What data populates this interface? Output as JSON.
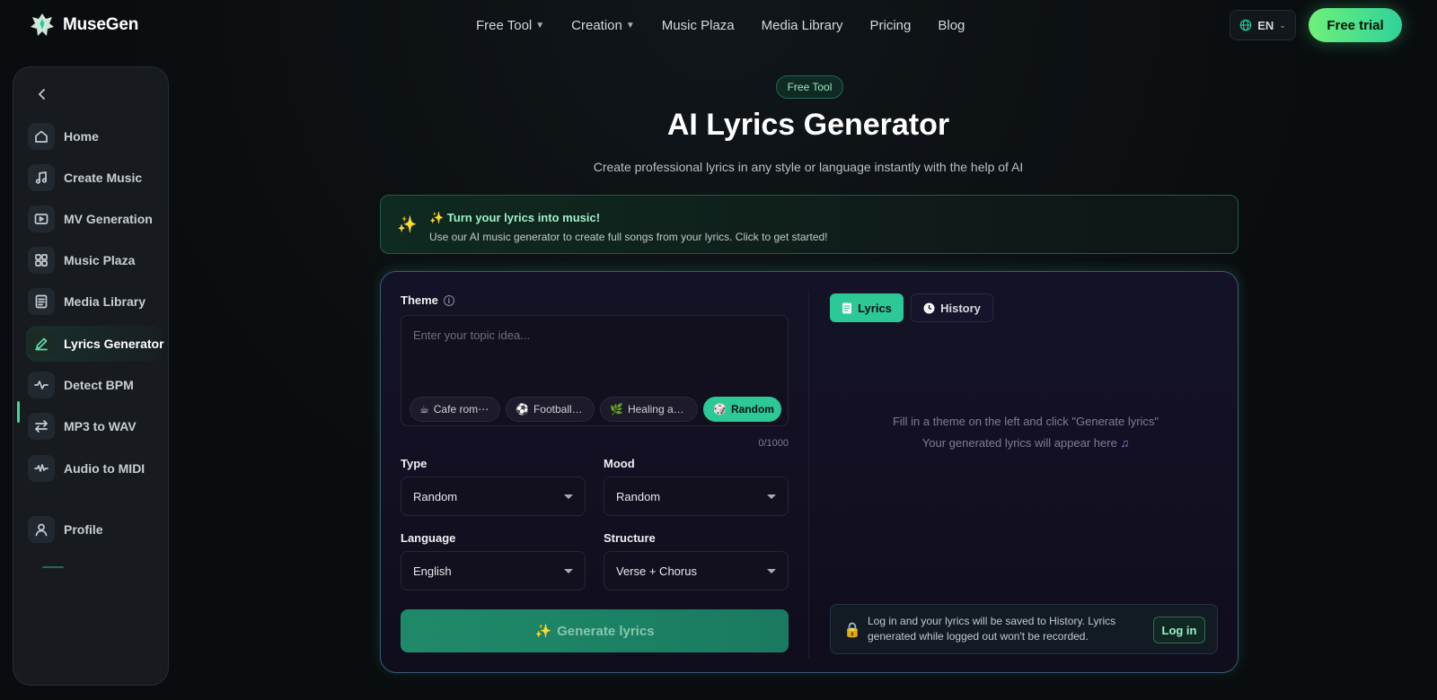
{
  "brand": {
    "name": "MuseGen"
  },
  "nav": {
    "links": [
      {
        "label": "Free Tool",
        "has_dropdown": true
      },
      {
        "label": "Creation",
        "has_dropdown": true
      },
      {
        "label": "Music Plaza",
        "has_dropdown": false
      },
      {
        "label": "Media Library",
        "has_dropdown": false
      },
      {
        "label": "Pricing",
        "has_dropdown": false
      },
      {
        "label": "Blog",
        "has_dropdown": false
      }
    ],
    "language": "EN",
    "trial_label": "Free trial"
  },
  "sidebar": {
    "items": [
      {
        "label": "Home",
        "icon": "home-icon"
      },
      {
        "label": "Create Music",
        "icon": "music-note-icon"
      },
      {
        "label": "MV Generation",
        "icon": "video-play-icon"
      },
      {
        "label": "Music Plaza",
        "icon": "grid-icon"
      },
      {
        "label": "Media Library",
        "icon": "document-icon"
      },
      {
        "label": "Lyrics Generator",
        "icon": "pen-icon",
        "active": true
      },
      {
        "label": "Detect BPM",
        "icon": "pulse-icon"
      },
      {
        "label": "MP3 to WAV",
        "icon": "swap-arrows-icon"
      },
      {
        "label": "Audio to MIDI",
        "icon": "waveform-icon"
      },
      {
        "label": "Profile",
        "icon": "user-icon"
      }
    ]
  },
  "hero": {
    "badge": "Free Tool",
    "title": "AI Lyrics Generator",
    "subtitle": "Create professional lyrics in any style or language instantly with the help of AI"
  },
  "promo": {
    "title": "✨ Turn your lyrics into music!",
    "description": "Use our AI music generator to create full songs from your lyrics. Click to get started!"
  },
  "form": {
    "theme_label": "Theme",
    "theme_placeholder": "Enter your topic idea...",
    "theme_value": "",
    "chips": [
      {
        "emoji": "☕",
        "label": "Cafe rom⋯"
      },
      {
        "emoji": "⚽",
        "label": "Football g⋯"
      },
      {
        "emoji": "🌿",
        "label": "Healing aft⋯"
      },
      {
        "emoji": "🎲",
        "label": "Random"
      }
    ],
    "char_count": "0/1000",
    "type_label": "Type",
    "type_value": "Random",
    "mood_label": "Mood",
    "mood_value": "Random",
    "language_label": "Language",
    "language_value": "English",
    "structure_label": "Structure",
    "structure_value": "Verse + Chorus",
    "generate_label": "Generate lyrics"
  },
  "output": {
    "tabs": [
      {
        "label": "Lyrics",
        "active": true
      },
      {
        "label": "History",
        "active": false
      }
    ],
    "empty_line1": "Fill in a theme on the left and click \"Generate lyrics\"",
    "empty_line2": "Your generated lyrics will appear here",
    "login_notice": "Log in and your lyrics will be saved to History. Lyrics generated while logged out won't be recorded.",
    "login_label": "Log in"
  },
  "colors": {
    "accent": "#2cc896",
    "background": "#0a0d0f",
    "panel": "#141226"
  }
}
